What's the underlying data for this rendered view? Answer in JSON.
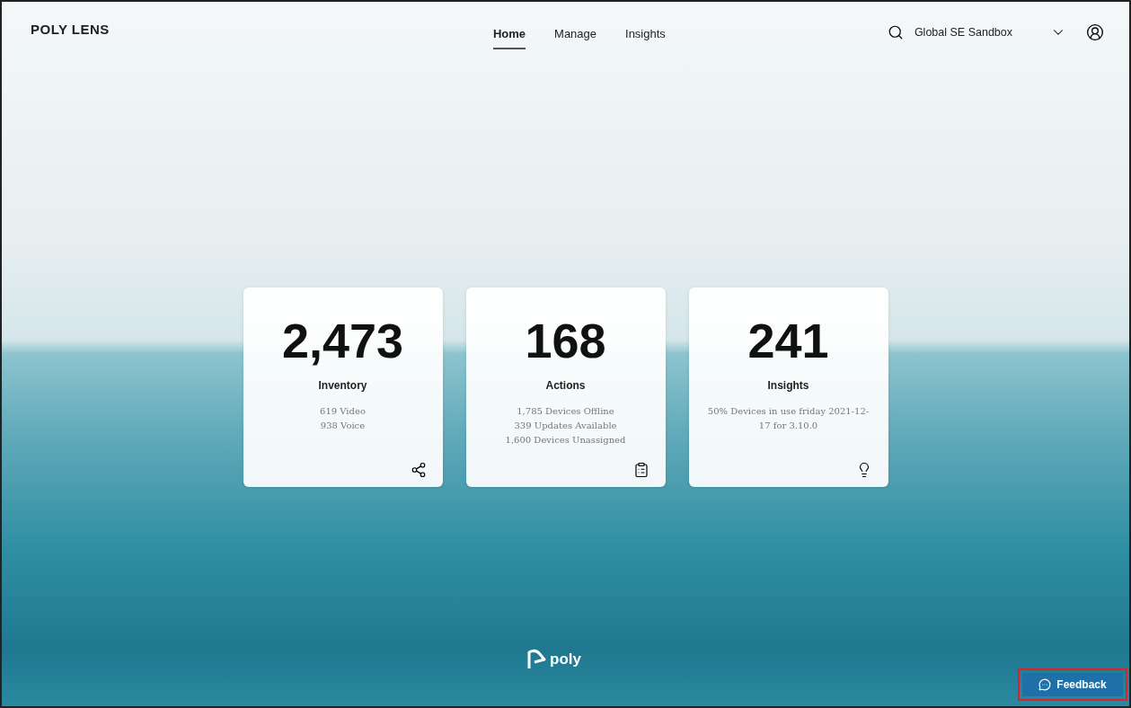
{
  "header": {
    "logo": "POLY LENS",
    "nav": [
      {
        "label": "Home",
        "selected": true
      },
      {
        "label": "Manage",
        "selected": false
      },
      {
        "label": "Insights",
        "selected": false
      }
    ],
    "tenant": "Global SE Sandbox"
  },
  "cards": [
    {
      "value": "2,473",
      "title": "Inventory",
      "lines": [
        "619 Video",
        "938 Voice"
      ]
    },
    {
      "value": "168",
      "title": "Actions",
      "lines": [
        "1,785 Devices Offline",
        "339 Updates Available",
        "1,600 Devices Unassigned"
      ]
    },
    {
      "value": "241",
      "title": "Insights",
      "lines": [
        "50% Devices in use friday 2021-12-17 for 3.10.0"
      ]
    }
  ],
  "footer": {
    "brand": "poly"
  },
  "feedback": {
    "label": "Feedback",
    "highlighted": true
  }
}
